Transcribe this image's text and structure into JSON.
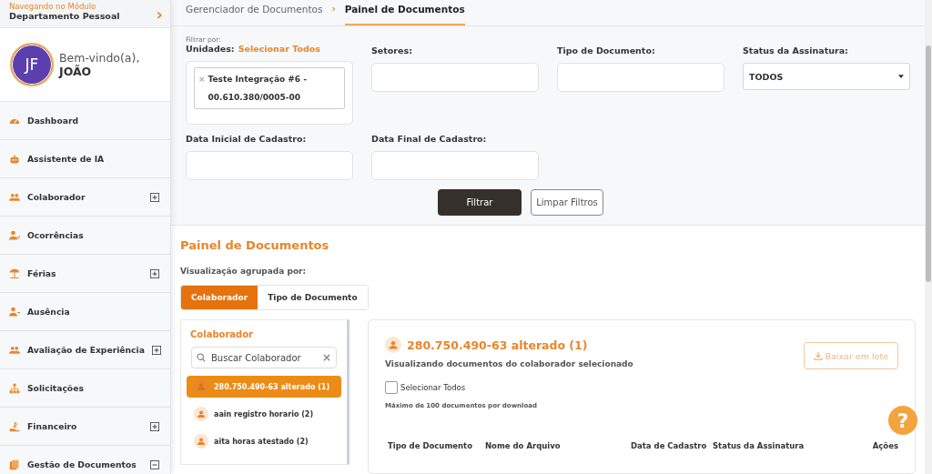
{
  "module": {
    "caption": "Navegando no Módulo",
    "name": "Departamento Pessoal",
    "arrow": "›"
  },
  "user": {
    "initials": "JF",
    "greeting": "Bem-vindo(a),",
    "name": "JOÃO"
  },
  "sidebar": {
    "items": [
      {
        "label": "Dashboard",
        "kind": "link"
      },
      {
        "label": "Assistente de IA",
        "kind": "link"
      },
      {
        "label": "Colaborador",
        "kind": "group",
        "expanded": false
      },
      {
        "label": "Ocorrências",
        "kind": "link"
      },
      {
        "label": "Férias",
        "kind": "group",
        "expanded": false
      },
      {
        "label": "Ausência",
        "kind": "link"
      },
      {
        "label": "Avaliação de Experiência",
        "kind": "group",
        "expanded": false
      },
      {
        "label": "Solicitações",
        "kind": "link"
      },
      {
        "label": "Financeiro",
        "kind": "group",
        "expanded": false
      },
      {
        "label": "Gestão de Documentos",
        "kind": "group",
        "expanded": true
      }
    ]
  },
  "breadcrumb": [
    {
      "label": "Gerenciador de Documentos",
      "selected": false
    },
    {
      "label": "Painel de Documentos",
      "selected": true
    }
  ],
  "breadcrumb_separator": "›",
  "filters": {
    "caption": "Filtrar por:",
    "units_label": "Unidades:",
    "select_all": "Selecionar Todos",
    "unit_tag": {
      "remove": "×",
      "text": "Teste Integração #6 - 00.610.380/0005-00"
    },
    "sectors_label": "Setores:",
    "doc_type_label": "Tipo de Documento:",
    "status_label": "Status da Assinatura:",
    "status_value": "TODOS",
    "start_label": "Data Inicial de Cadastro:",
    "end_label": "Data Final de Cadastro:",
    "filter_button": "Filtrar",
    "clear_button": "Limpar Filtros"
  },
  "panel": {
    "title": "Painel de Documentos",
    "group_label": "Visualização agrupada por:",
    "group_tabs": [
      {
        "label": "Colaborador",
        "selected": true
      },
      {
        "label": "Tipo de Documento",
        "selected": false
      }
    ],
    "list_title": "Colaborador",
    "search": {
      "placeholder": "Buscar Colaborador",
      "clear": "×"
    },
    "collaborators": [
      {
        "label": "280.750.490-63 alterado (1)",
        "selected": true
      },
      {
        "label": "aain registro horario (2)",
        "selected": false
      },
      {
        "label": "aita horas atestado (2)",
        "selected": false
      }
    ],
    "detail": {
      "title": "280.750.490-63 alterado (1)",
      "subtitle": "Visualizando documentos do colaborador selecionado",
      "batch_button": "Baixar em lote",
      "batch_disabled": true,
      "select_all": {
        "label": "Selecionar Todos",
        "checked": false
      },
      "limit_note": "Máximo de 100 documentos por download",
      "columns": [
        "Tipo de Documento",
        "Nome do Arquivo",
        "Data de Cadastro",
        "Status da Assinatura",
        "Ações"
      ]
    }
  },
  "help": "?"
}
